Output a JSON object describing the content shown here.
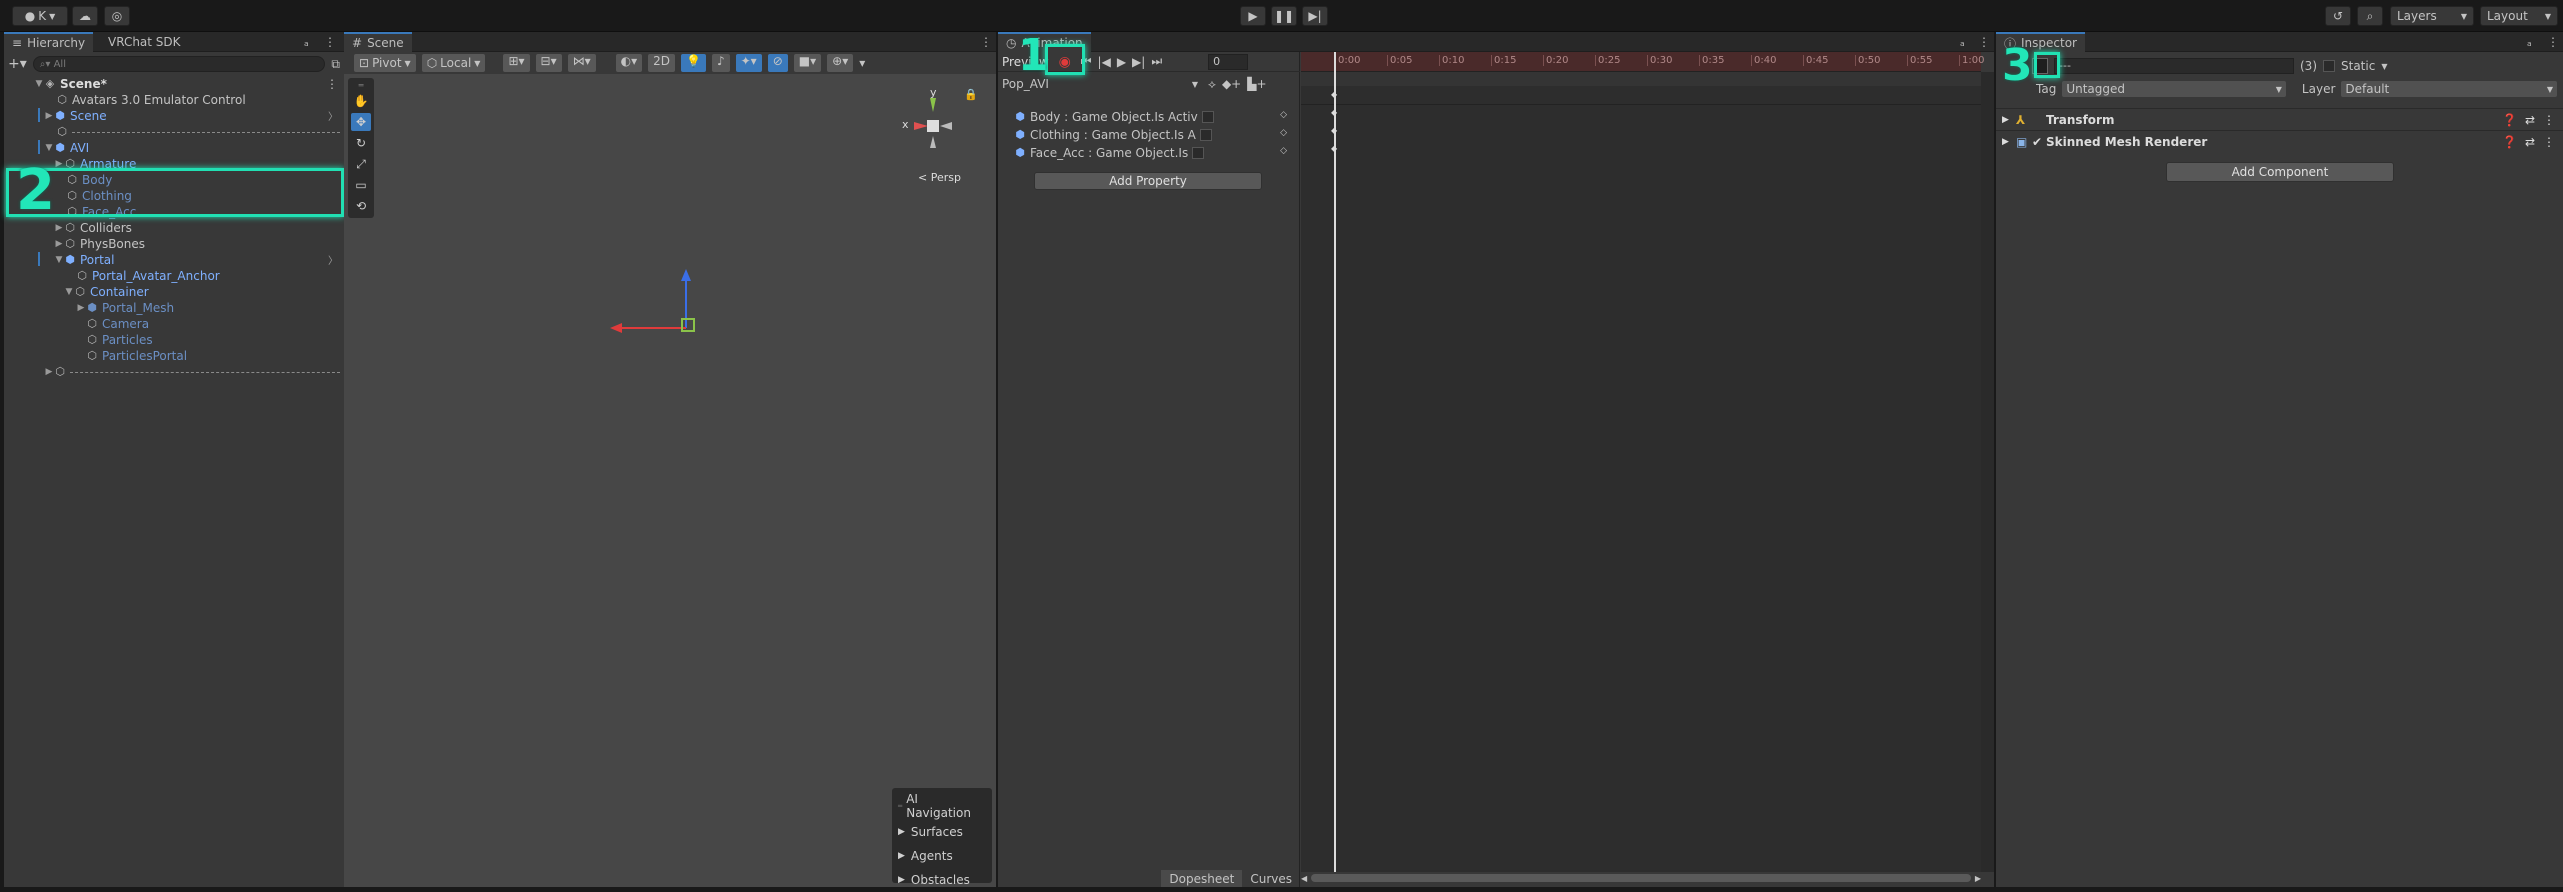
{
  "topbar": {
    "account_label": "K",
    "cloud_icon": "cloud-icon",
    "collab_icon": "circle-icon",
    "play_icon": "play-icon",
    "pause_icon": "pause-icon",
    "step_icon": "step-icon",
    "history_icon": "history-icon",
    "search_icon": "search-icon",
    "layers_label": "Layers",
    "layout_label": "Layout"
  },
  "hierarchy": {
    "tabs": [
      "Hierarchy",
      "VRChat SDK"
    ],
    "search_placeholder": "All",
    "items": [
      {
        "label": "Scene*",
        "style": "scene"
      },
      {
        "label": "Avatars 3.0 Emulator Control",
        "style": "normal"
      },
      {
        "label": "Scene",
        "style": "blue"
      },
      {
        "label": "",
        "style": "separator"
      },
      {
        "label": "AVI",
        "style": "blue"
      },
      {
        "label": "Armature",
        "style": "blue"
      },
      {
        "label": "Body",
        "style": "dim"
      },
      {
        "label": "Clothing",
        "style": "dim"
      },
      {
        "label": "Face_Acc",
        "style": "dim"
      },
      {
        "label": "Colliders",
        "style": "normal"
      },
      {
        "label": "PhysBones",
        "style": "normal"
      },
      {
        "label": "Portal",
        "style": "blue"
      },
      {
        "label": "Portal_Avatar_Anchor",
        "style": "blue"
      },
      {
        "label": "Container",
        "style": "blue"
      },
      {
        "label": "Portal_Mesh",
        "style": "dim"
      },
      {
        "label": "Camera",
        "style": "dim"
      },
      {
        "label": "Particles",
        "style": "dim"
      },
      {
        "label": "ParticlesPortal",
        "style": "dim"
      },
      {
        "label": "",
        "style": "separator"
      }
    ]
  },
  "scene": {
    "tab": "Scene",
    "pivot": "Pivot",
    "local": "Local",
    "mode_2d": "2D",
    "persp": "< Persp",
    "gizmo_y": "y",
    "gizmo_x": "x",
    "ai_nav": {
      "title": "AI Navigation",
      "items": [
        "Surfaces",
        "Agents",
        "Obstacles"
      ]
    }
  },
  "animation": {
    "tab": "Animation",
    "preview": "Preview",
    "frame": "0",
    "clip": "Pop_AVI",
    "properties": [
      "Body : Game Object.Is Activ",
      "Clothing : Game Object.Is A",
      "Face_Acc : Game Object.Is"
    ],
    "add_property": "Add Property",
    "timeline_ticks": [
      "0:00",
      "0:05",
      "0:10",
      "0:15",
      "0:20",
      "0:25",
      "0:30",
      "0:35",
      "0:40",
      "0:45",
      "0:50",
      "0:55",
      "1:00"
    ],
    "dopesheet": "Dopesheet",
    "curves": "Curves"
  },
  "inspector": {
    "tab": "Inspector",
    "name_value": "---",
    "count": "(3)",
    "static": "Static",
    "tag_label": "Tag",
    "tag_value": "Untagged",
    "layer_label": "Layer",
    "layer_value": "Default",
    "components": [
      "Transform",
      "Skinned Mesh Renderer"
    ],
    "add_component": "Add Component"
  },
  "annotations": [
    "1",
    "2",
    "3"
  ],
  "colors": {
    "highlight": "#21e0b3",
    "record": "#e03b3b",
    "selection": "#3a79bb"
  }
}
